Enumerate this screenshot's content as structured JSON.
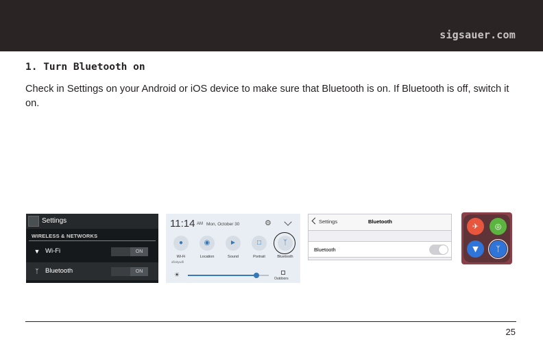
{
  "header": {
    "site": "sigsauer.com",
    "background": "#2a2524"
  },
  "section": {
    "heading": "1. Turn Bluetooth on",
    "body": "Check in Settings on your Android or iOS device to make sure that Bluetooth is on. If Bluetooth is off, switch it on."
  },
  "android_settings": {
    "title": "Settings",
    "section_label": "WIRELESS & NETWORKS",
    "rows": [
      {
        "label": "Wi-Fi",
        "toggle": "ON",
        "icon": "wifi-icon"
      },
      {
        "label": "Bluetooth",
        "toggle": "ON",
        "icon": "bluetooth-icon"
      }
    ]
  },
  "quick_panel": {
    "time": "11:14",
    "ampm": "AM",
    "date": "Mon, October 30",
    "tiles": [
      {
        "label": "Wi-Fi",
        "icon": "wifi-icon"
      },
      {
        "label": "Location",
        "icon": "location-icon"
      },
      {
        "label": "Sound",
        "icon": "sound-icon"
      },
      {
        "label": "Portrait",
        "icon": "portrait-lock-icon"
      },
      {
        "label": "Bluetooth",
        "icon": "bluetooth-icon"
      }
    ],
    "wifi_network": "xfinitywifi",
    "brightness_level": 0.85,
    "outdoors_label": "Outdoors",
    "accent": "#3779b8"
  },
  "ios_bluetooth": {
    "back_label": "Settings",
    "nav_title": "Bluetooth",
    "row_label": "Bluetooth",
    "switch_on": false
  },
  "control_center": {
    "tiles": [
      {
        "icon": "airplane-icon",
        "color": "#e9563e"
      },
      {
        "icon": "cellular-icon",
        "color": "#5bb43f"
      },
      {
        "icon": "wifi-icon",
        "color": "#2f74d8"
      },
      {
        "icon": "bluetooth-icon",
        "color": "#2f74d8"
      }
    ]
  },
  "footer": {
    "page_number": "25"
  }
}
